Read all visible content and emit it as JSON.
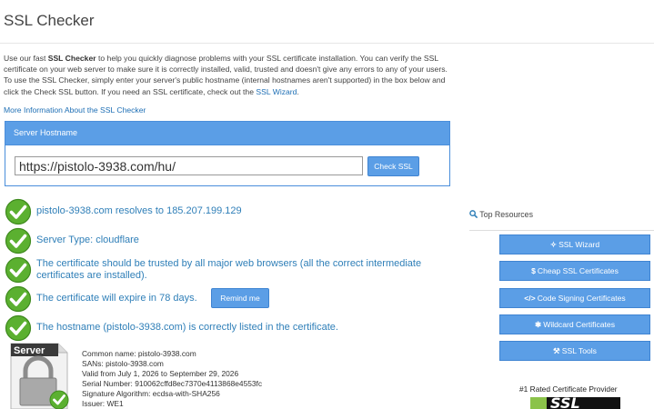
{
  "header": {
    "title": "SSL Checker"
  },
  "intro": {
    "part1": "Use our fast ",
    "bold": "SSL Checker",
    "part2": " to help you quickly diagnose problems with your SSL certificate installation. You can verify the SSL certificate on your web server to make sure it is correctly installed, valid, trusted and doesn't give any errors to any of your users. To use the SSL Checker, simply enter your server's public hostname (internal hostnames aren't supported) in the box below and click the Check SSL button. If you need an SSL certificate, check out the ",
    "wizard_link": "SSL Wizard",
    "end": "."
  },
  "more_link": "More Information About the SSL Checker",
  "form": {
    "panel_title": "Server Hostname",
    "hostname_value": "https://pistolo-3938.com/hu/",
    "check_button": "Check SSL"
  },
  "results": [
    {
      "text": "pistolo-3938.com resolves to 185.207.199.129"
    },
    {
      "text": "Server Type: cloudflare"
    },
    {
      "text": "The certificate should be trusted by all major web browsers (all the correct intermediate certificates are installed)."
    },
    {
      "text": "The certificate will expire in 78 days."
    },
    {
      "text": "The hostname (pistolo-3938.com) is correctly listed in the certificate."
    }
  ],
  "remind_button": "Remind me",
  "cert_graphic_label": "Server",
  "cert": {
    "common_name_label": "Common name:",
    "common_name": "pistolo-3938.com",
    "sans_label": "SANs:",
    "sans": "pistolo-3938.com",
    "valid_label": "Valid",
    "valid": "from July 1, 2026 to September 29, 2026",
    "serial_label": "Serial Number:",
    "serial": "910062cffd8ec7370e4113868e4553fc",
    "sigalg_label": "Signature Algorithm:",
    "sigalg": "ecdsa-with-SHA256",
    "issuer_label": "Issuer:",
    "issuer": "WE1"
  },
  "sidebar": {
    "title": "Top Resources",
    "buttons": [
      {
        "icon": "magic-wand-icon",
        "label": "SSL Wizard"
      },
      {
        "icon": "dollar-icon",
        "label": "Cheap SSL Certificates"
      },
      {
        "icon": "code-icon",
        "label": "Code Signing Certificates"
      },
      {
        "icon": "asterisk-icon",
        "label": "Wildcard Certificates"
      },
      {
        "icon": "wrench-icon",
        "label": "SSL Tools"
      }
    ],
    "rated_text": "#1 Rated Certificate Provider",
    "logo_text": "SSL"
  },
  "colors": {
    "accent": "#5b9ee6",
    "link": "#1e6fb5",
    "check_green": "#5bb030"
  }
}
